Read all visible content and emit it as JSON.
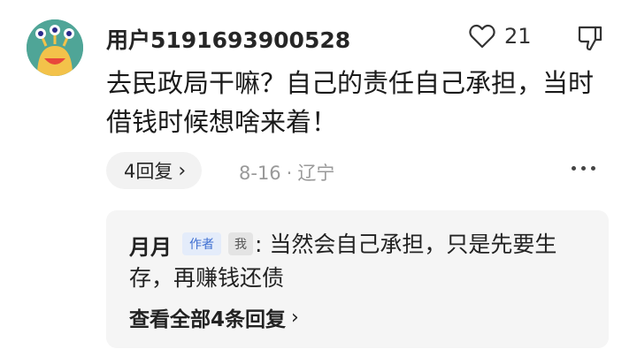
{
  "comment": {
    "username": "用户5191693900528",
    "text": "去民政局干嘛？自己的责任自己承担，当时借钱时候想啥来着！",
    "like_count": "21",
    "replies_label": "4回复",
    "date": "8-16",
    "location": "辽宁"
  },
  "reply": {
    "author": "月月",
    "author_tag": "作者",
    "me_tag": "我",
    "text": ": 当然会自己承担，只是先要生存，再赚钱还债",
    "view_all_label": "查看全部4条回复"
  },
  "icons": {
    "avatar": "monster-avatar",
    "like": "heart-icon",
    "dislike": "thumbs-down-icon",
    "more": "more-dots-icon",
    "reply_chevron": "chevron-right-icon"
  },
  "colors": {
    "avatar_bg": "#4fa597",
    "author_tag_bg": "#e4ecfa",
    "author_tag_text": "#3f6fd1",
    "reply_box_bg": "#f5f5f5"
  }
}
